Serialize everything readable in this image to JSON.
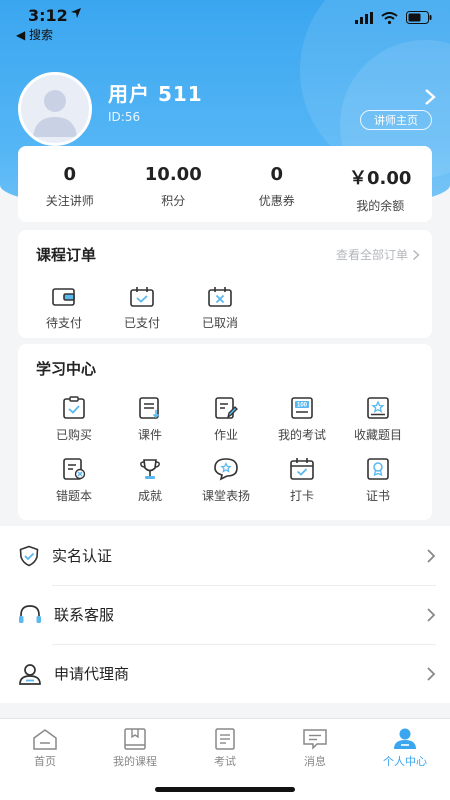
{
  "status_bar": {
    "time": "3:12",
    "back_label": "◀ 搜索"
  },
  "profile": {
    "username": "用户 511",
    "id_text": "ID:56",
    "lecturer_button": "讲师主页"
  },
  "stats": [
    {
      "value": "0",
      "label": "关注讲师"
    },
    {
      "value": "10.00",
      "label": "积分"
    },
    {
      "value": "0",
      "label": "优惠券"
    },
    {
      "value": "￥0.00",
      "label": "我的余额"
    }
  ],
  "orders": {
    "title": "课程订单",
    "view_all": "查看全部订单",
    "items": [
      {
        "label": "待支付",
        "icon": "wallet-icon"
      },
      {
        "label": "已支付",
        "icon": "calendar-check-icon"
      },
      {
        "label": "已取消",
        "icon": "calendar-x-icon"
      }
    ]
  },
  "study": {
    "title": "学习中心",
    "items": [
      {
        "label": "已购买",
        "icon": "clipboard-check-icon"
      },
      {
        "label": "课件",
        "icon": "courseware-icon"
      },
      {
        "label": "作业",
        "icon": "homework-icon"
      },
      {
        "label": "我的考试",
        "icon": "exam-100-icon"
      },
      {
        "label": "收藏题目",
        "icon": "bookmark-star-icon"
      },
      {
        "label": "错题本",
        "icon": "mistake-book-icon"
      },
      {
        "label": "成就",
        "icon": "trophy-icon"
      },
      {
        "label": "课堂表扬",
        "icon": "praise-bubble-icon"
      },
      {
        "label": "打卡",
        "icon": "check-in-calendar-icon"
      },
      {
        "label": "证书",
        "icon": "certificate-icon"
      }
    ]
  },
  "menu": [
    {
      "label": "实名认证",
      "icon": "shield-check-icon"
    },
    {
      "label": "联系客服",
      "icon": "headset-icon"
    },
    {
      "label": "申请代理商",
      "icon": "agent-user-icon"
    }
  ],
  "tabbar": [
    {
      "label": "首页",
      "icon": "home-icon",
      "active": false
    },
    {
      "label": "我的课程",
      "icon": "course-book-icon",
      "active": false
    },
    {
      "label": "考试",
      "icon": "exam-doc-icon",
      "active": false
    },
    {
      "label": "消息",
      "icon": "message-icon",
      "active": false
    },
    {
      "label": "个人中心",
      "icon": "profile-icon",
      "active": true
    }
  ],
  "colors": {
    "accent": "#3aa6f0",
    "icon_stroke": "#333333",
    "icon_accent": "#5ab8f0"
  }
}
